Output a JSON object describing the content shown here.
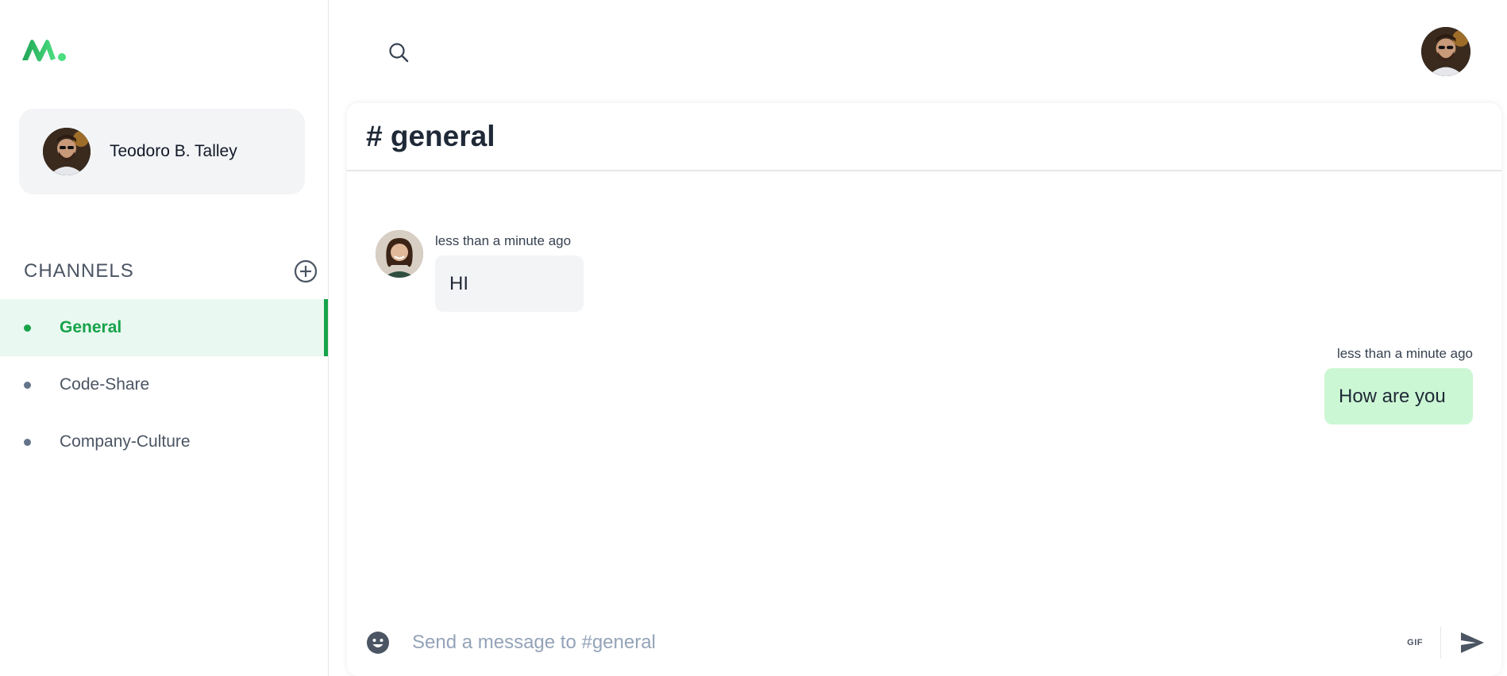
{
  "sidebar": {
    "user": {
      "name": "Teodoro B. Talley"
    },
    "channels_label": "CHANNELS",
    "channels": [
      {
        "label": "General",
        "active": true
      },
      {
        "label": "Code-Share",
        "active": false
      },
      {
        "label": "Company-Culture",
        "active": false
      }
    ]
  },
  "chat": {
    "title": "# general",
    "messages": [
      {
        "time": "less than a minute ago",
        "text": "HI",
        "direction": "incoming"
      },
      {
        "time": "less than a minute ago",
        "text": "How are you",
        "direction": "outgoing"
      }
    ],
    "composer": {
      "placeholder": "Send a message to #general",
      "gif_label": "GIF"
    }
  },
  "icons": {
    "logo": "logo-icon",
    "search": "search-icon",
    "add": "plus-circle-icon",
    "emoji": "smiley-icon",
    "send": "send-icon"
  },
  "colors": {
    "accent": "#16a34a",
    "active_bg": "#e9f8f0",
    "outgoing_bubble": "#ccf7d4",
    "incoming_bubble": "#f3f4f6"
  }
}
